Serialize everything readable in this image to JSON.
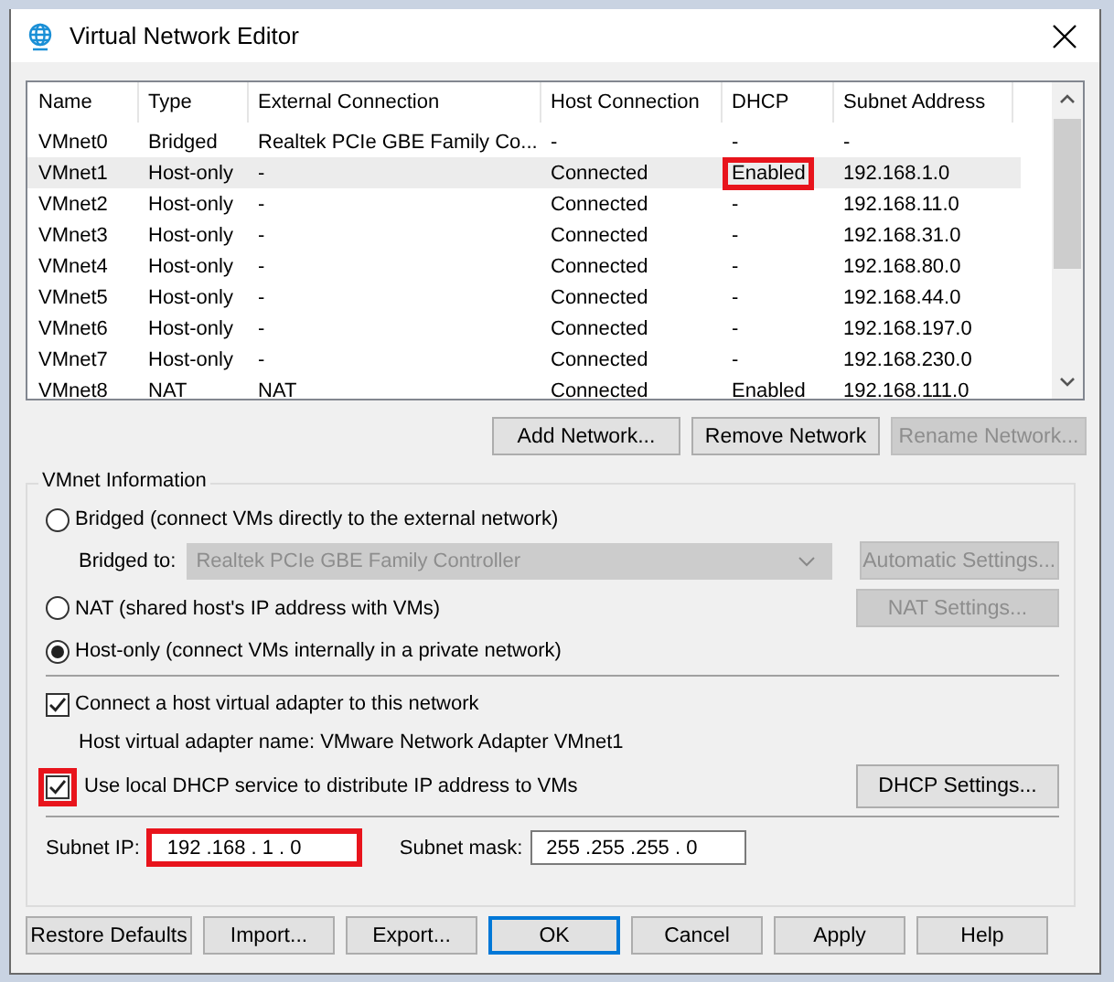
{
  "window": {
    "title": "Virtual Network Editor"
  },
  "table": {
    "columns": [
      "Name",
      "Type",
      "External Connection",
      "Host Connection",
      "DHCP",
      "Subnet Address"
    ],
    "rows": [
      {
        "cells": [
          "VMnet0",
          "Bridged",
          "Realtek PCIe GBE Family Co...",
          "-",
          "-",
          "-"
        ],
        "selected": false,
        "dhcp_marked": false
      },
      {
        "cells": [
          "VMnet1",
          "Host-only",
          "-",
          "Connected",
          "Enabled",
          "192.168.1.0"
        ],
        "selected": true,
        "dhcp_marked": true
      },
      {
        "cells": [
          "VMnet2",
          "Host-only",
          "-",
          "Connected",
          "-",
          "192.168.11.0"
        ],
        "selected": false,
        "dhcp_marked": false
      },
      {
        "cells": [
          "VMnet3",
          "Host-only",
          "-",
          "Connected",
          "-",
          "192.168.31.0"
        ],
        "selected": false,
        "dhcp_marked": false
      },
      {
        "cells": [
          "VMnet4",
          "Host-only",
          "-",
          "Connected",
          "-",
          "192.168.80.0"
        ],
        "selected": false,
        "dhcp_marked": false
      },
      {
        "cells": [
          "VMnet5",
          "Host-only",
          "-",
          "Connected",
          "-",
          "192.168.44.0"
        ],
        "selected": false,
        "dhcp_marked": false
      },
      {
        "cells": [
          "VMnet6",
          "Host-only",
          "-",
          "Connected",
          "-",
          "192.168.197.0"
        ],
        "selected": false,
        "dhcp_marked": false
      },
      {
        "cells": [
          "VMnet7",
          "Host-only",
          "-",
          "Connected",
          "-",
          "192.168.230.0"
        ],
        "selected": false,
        "dhcp_marked": false
      },
      {
        "cells": [
          "VMnet8",
          "NAT",
          "NAT",
          "Connected",
          "Enabled",
          "192.168.111.0"
        ],
        "selected": false,
        "dhcp_marked": false
      }
    ]
  },
  "table_buttons": [
    {
      "label": "Add Network...",
      "disabled": false
    },
    {
      "label": "Remove Network",
      "disabled": false
    },
    {
      "label": "Rename Network...",
      "disabled": true
    }
  ],
  "vmnet_info": {
    "title": "VMnet Information",
    "bridged": {
      "label": "Bridged (connect VMs directly to the external network)",
      "selected": false
    },
    "bridged_to": {
      "label": "Bridged to:",
      "value": "Realtek PCIe GBE Family Controller",
      "disabled": true
    },
    "automatic_settings": {
      "label": "Automatic Settings...",
      "disabled": true
    },
    "nat": {
      "label": "NAT (shared host's IP address with VMs)",
      "selected": false
    },
    "nat_settings": {
      "label": "NAT Settings...",
      "disabled": true
    },
    "host_only": {
      "label": "Host-only (connect VMs internally in a private network)",
      "selected": true
    },
    "connect_adapter": {
      "label": "Connect a host virtual adapter to this network",
      "checked": true
    },
    "adapter_name": "Host virtual adapter name: VMware Network Adapter VMnet1",
    "use_dhcp": {
      "label": "Use local DHCP service to distribute IP address to VMs",
      "checked": true,
      "marked": true
    },
    "dhcp_settings": {
      "label": "DHCP Settings...",
      "disabled": false
    },
    "subnet_ip": {
      "label": "Subnet IP:",
      "value": "192 .168 . 1 . 0",
      "marked": true
    },
    "subnet_mask": {
      "label": "Subnet mask:",
      "value": "255 .255 .255 . 0"
    }
  },
  "buttons": [
    {
      "label": "Restore Defaults",
      "default": false
    },
    {
      "label": "Import...",
      "default": false
    },
    {
      "label": "Export...",
      "default": false
    },
    {
      "label": "OK",
      "default": true
    },
    {
      "label": "Cancel",
      "default": false
    },
    {
      "label": "Apply",
      "default": false
    },
    {
      "label": "Help",
      "default": false
    }
  ]
}
